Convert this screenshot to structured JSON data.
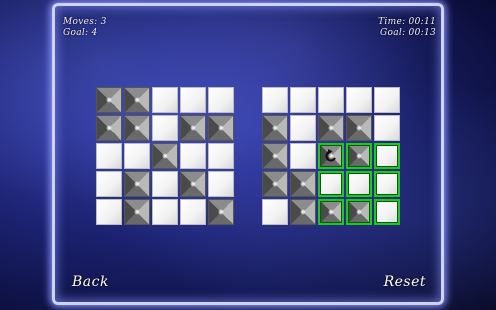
{
  "hud": {
    "moves_label": "Moves: 3",
    "goal_label": "Goal: 4",
    "time_label": "Time: 00:11",
    "goal_time_label": "Goal: 00:13"
  },
  "buttons": {
    "back": "Back",
    "reset": "Reset"
  },
  "target_board": [
    [
      "dark",
      "dark",
      "white",
      "white",
      "white"
    ],
    [
      "dark",
      "dark",
      "white",
      "dark",
      "dark"
    ],
    [
      "white",
      "white",
      "dark",
      "white",
      "white"
    ],
    [
      "white",
      "dark",
      "white",
      "dark",
      "white"
    ],
    [
      "white",
      "dark",
      "white",
      "white",
      "dark"
    ]
  ],
  "play_board": [
    [
      "white",
      "white",
      "white",
      "white",
      "white"
    ],
    [
      "dark",
      "white",
      "dark",
      "dark",
      "white"
    ],
    [
      "dark",
      "white",
      "dark",
      "dark",
      "white"
    ],
    [
      "dark",
      "dark",
      "white",
      "white",
      "white"
    ],
    [
      "white",
      "dark",
      "dark",
      "dark",
      "white"
    ]
  ],
  "selection": {
    "rows": [
      2,
      3,
      4
    ],
    "cols": [
      2,
      3,
      4
    ],
    "rotate_icon_cell": [
      2,
      2
    ]
  },
  "colors": {
    "selection_border": "#1ec81e",
    "panel_glow": "#8c95ff"
  }
}
